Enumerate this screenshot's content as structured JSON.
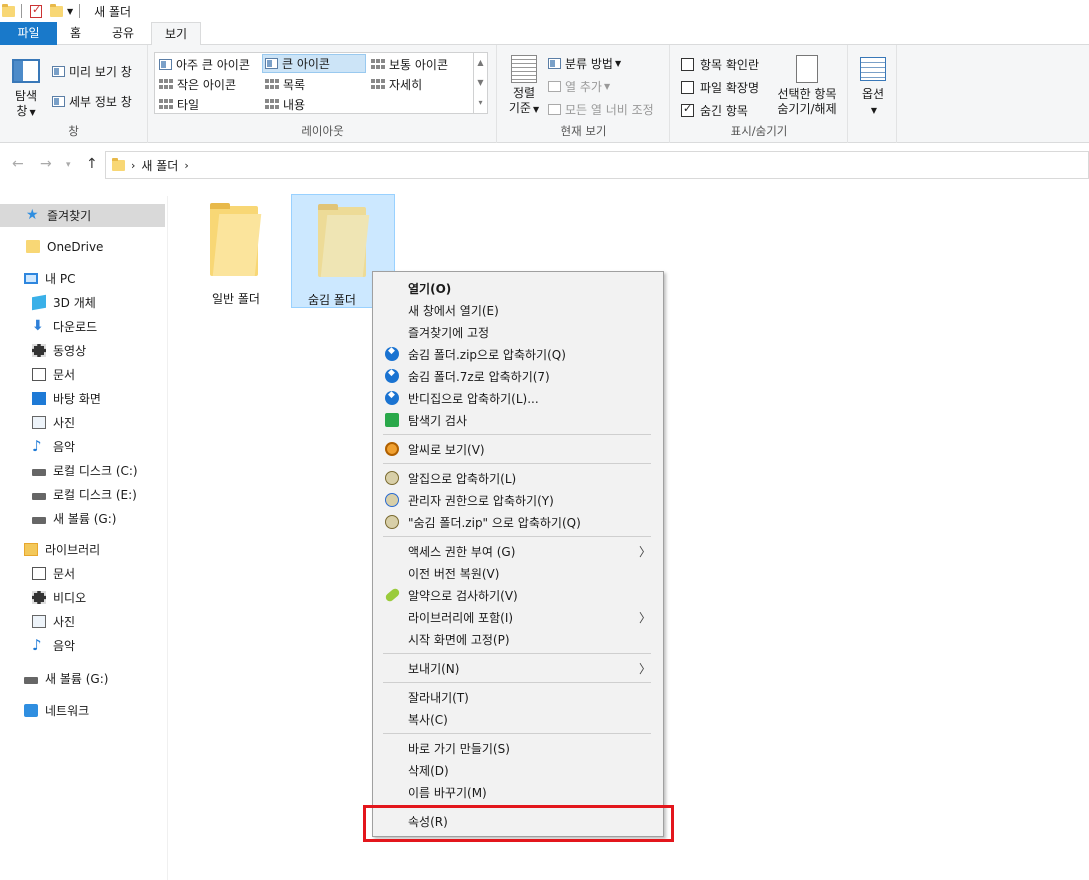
{
  "titlebar": {
    "title": "새 폴더"
  },
  "tabs": {
    "file": "파일",
    "home": "홈",
    "share": "공유",
    "view": "보기"
  },
  "ribbon": {
    "panes": {
      "nav_pane": "탐색",
      "nav_pane2": "창",
      "preview": "미리 보기 창",
      "details": "세부 정보 창",
      "label": "창"
    },
    "layout": {
      "xl_icons": "아주 큰 아이콘",
      "l_icons": "큰 아이콘",
      "m_icons": "보통 아이콘",
      "s_icons": "작은 아이콘",
      "list": "목록",
      "details": "자세히",
      "tiles": "타일",
      "content": "내용",
      "label": "레이아웃"
    },
    "current_view": {
      "sort1": "정렬",
      "sort2": "기준",
      "group_by": "분류 방법",
      "add_column": "열 추가",
      "fit_columns": "모든 열 너비 조정",
      "label": "현재 보기"
    },
    "show_hide": {
      "item_checkboxes": "항목 확인란",
      "file_ext": "파일 확장명",
      "hidden_items": "숨긴 항목",
      "hide_selected1": "선택한 항목",
      "hide_selected2": "숨기기/해제",
      "label": "표시/숨기기"
    },
    "options": "옵션"
  },
  "address": {
    "path": "새 폴더"
  },
  "nav": {
    "quick_access": "즐겨찾기",
    "onedrive": "OneDrive",
    "this_pc": "내 PC",
    "objects3d": "3D 개체",
    "downloads": "다운로드",
    "videos": "동영상",
    "documents": "문서",
    "desktop": "바탕 화면",
    "pictures": "사진",
    "music": "음악",
    "local_c": "로컬 디스크 (C:)",
    "local_e": "로컬 디스크 (E:)",
    "new_vol_g": "새 볼륨 (G:)",
    "libraries": "라이브러리",
    "lib_documents": "문서",
    "lib_video": "비디오",
    "lib_pictures": "사진",
    "lib_music": "음악",
    "new_vol_g2": "새 볼륨 (G:)",
    "network": "네트워크"
  },
  "files": [
    {
      "name": "일반 폴더",
      "selected": false
    },
    {
      "name": "숨김 폴더",
      "selected": true
    }
  ],
  "context_menu": {
    "open": "열기(O)",
    "open_new_window": "새 창에서 열기(E)",
    "pin_quick": "즐겨찾기에 고정",
    "bandi_zip": "숨김 폴더.zip으로 압축하기(Q)",
    "bandi_7z": "숨김 폴더.7z로 압축하기(7)",
    "bandi_more": "반디집으로 압축하기(L)...",
    "v3_scan": "탐색기 검사",
    "alsee": "알씨로 보기(V)",
    "alzip": "알집으로 압축하기(L)",
    "alzip_admin": "관리자 권한으로 압축하기(Y)",
    "alzip_named": "\"숨김 폴더.zip\" 으로 압축하기(Q)",
    "give_access": "액세스 권한 부여 (G)",
    "restore_prev": "이전 버전 복원(V)",
    "alyac": "알약으로 검사하기(V)",
    "include_library": "라이브러리에 포함(I)",
    "pin_start": "시작 화면에 고정(P)",
    "send_to": "보내기(N)",
    "cut": "잘라내기(T)",
    "copy": "복사(C)",
    "create_shortcut": "바로 가기 만들기(S)",
    "delete": "삭제(D)",
    "rename": "이름 바꾸기(M)",
    "properties": "속성(R)"
  },
  "colors": {
    "accent": "#1979ca",
    "selection": "#cce8ff",
    "highlight": "#e3161c"
  }
}
